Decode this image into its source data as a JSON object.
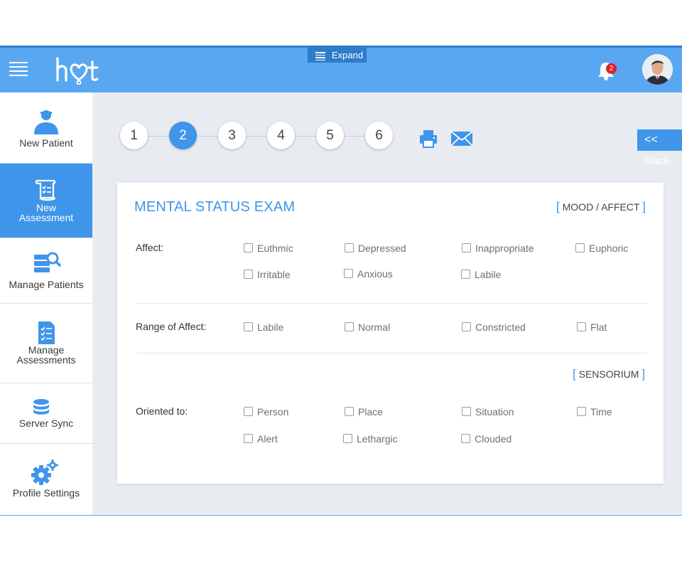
{
  "header": {
    "logo_text": "hot",
    "expand_label": "Expand",
    "notifications_count": "2"
  },
  "sidebar": {
    "items": [
      {
        "label": "New Patient",
        "icon": "person-icon"
      },
      {
        "label": "New\nAssessment",
        "icon": "scroll-checklist-icon",
        "active": true
      },
      {
        "label": "Manage Patients",
        "icon": "server-search-icon"
      },
      {
        "label": "Manage\nAssessments",
        "icon": "document-checklist-icon"
      },
      {
        "label": "Server Sync",
        "icon": "database-icon"
      },
      {
        "label": "Profile Settings",
        "icon": "gears-icon"
      }
    ]
  },
  "steps": {
    "items": [
      "1",
      "2",
      "3",
      "4",
      "5",
      "6"
    ],
    "active": "2"
  },
  "toolbar": {
    "back_label": "<< Back"
  },
  "card": {
    "title": "MENTAL STATUS EXAM",
    "section_mood": "MOOD / AFFECT",
    "section_sensorium": "SENSORIUM",
    "affect": {
      "label": "Affect:",
      "options": [
        "Euthmic",
        "Depressed",
        "Inappropriate",
        "Euphoric",
        "Irritable",
        "Anxious",
        "Labile"
      ]
    },
    "range": {
      "label": "Range of Affect:",
      "options": [
        "Labile",
        "Normal",
        "Constricted",
        "Flat"
      ]
    },
    "oriented": {
      "label": "Oriented to:",
      "options": [
        "Person",
        "Place",
        "Situation",
        "Time",
        "Alert",
        "Lethargic",
        "Clouded"
      ]
    }
  },
  "colors": {
    "accent": "#3f95ea",
    "header": "#5aa7f1",
    "badge": "#e02020",
    "content_bg": "#e8ecf1"
  }
}
